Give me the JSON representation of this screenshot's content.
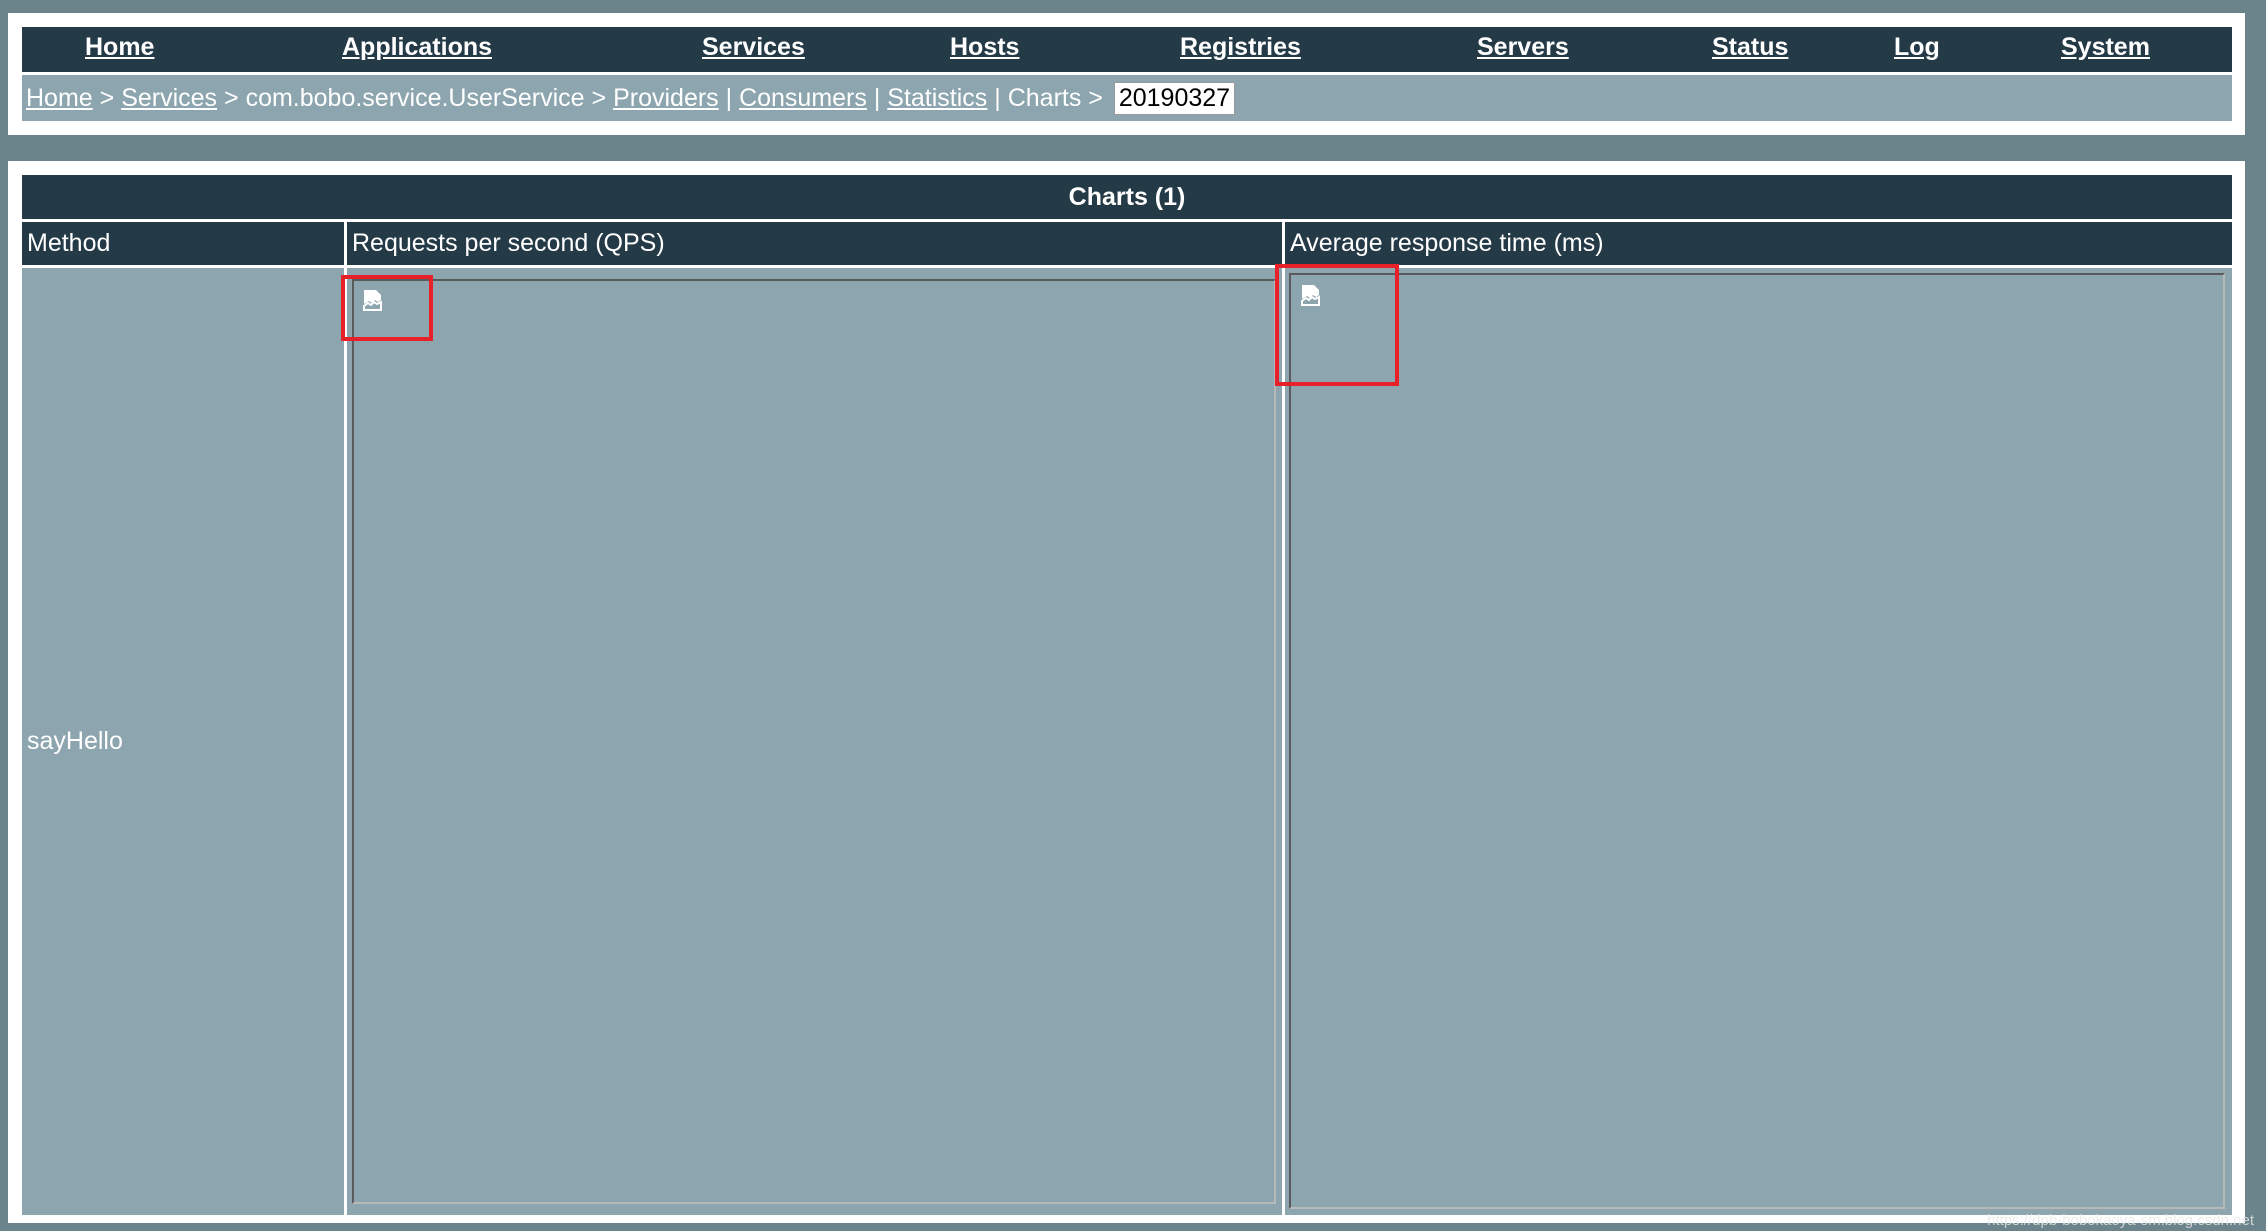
{
  "nav": {
    "items": [
      "Home",
      "Applications",
      "Services",
      "Hosts",
      "Registries",
      "Servers",
      "Status",
      "Log",
      "System"
    ]
  },
  "breadcrumb": {
    "home": "Home",
    "services": "Services",
    "service_name": "com.bobo.service.UserService",
    "providers": "Providers",
    "consumers": "Consumers",
    "statistics": "Statistics",
    "charts": "Charts",
    "sep_arrow": " > ",
    "sep_pipe": " | ",
    "date": "20190327"
  },
  "table": {
    "title": "Charts (1)",
    "headers": [
      "Method",
      "Requests per second (QPS)",
      "Average response time (ms)"
    ],
    "rows": [
      {
        "method": "sayHello",
        "qps_image": "broken-image-icon",
        "rt_image": "broken-image-icon"
      }
    ]
  },
  "highlight_color": "#e8202a",
  "watermark": "https://dpb-bobokaoya-sm.blog.csdn.net"
}
